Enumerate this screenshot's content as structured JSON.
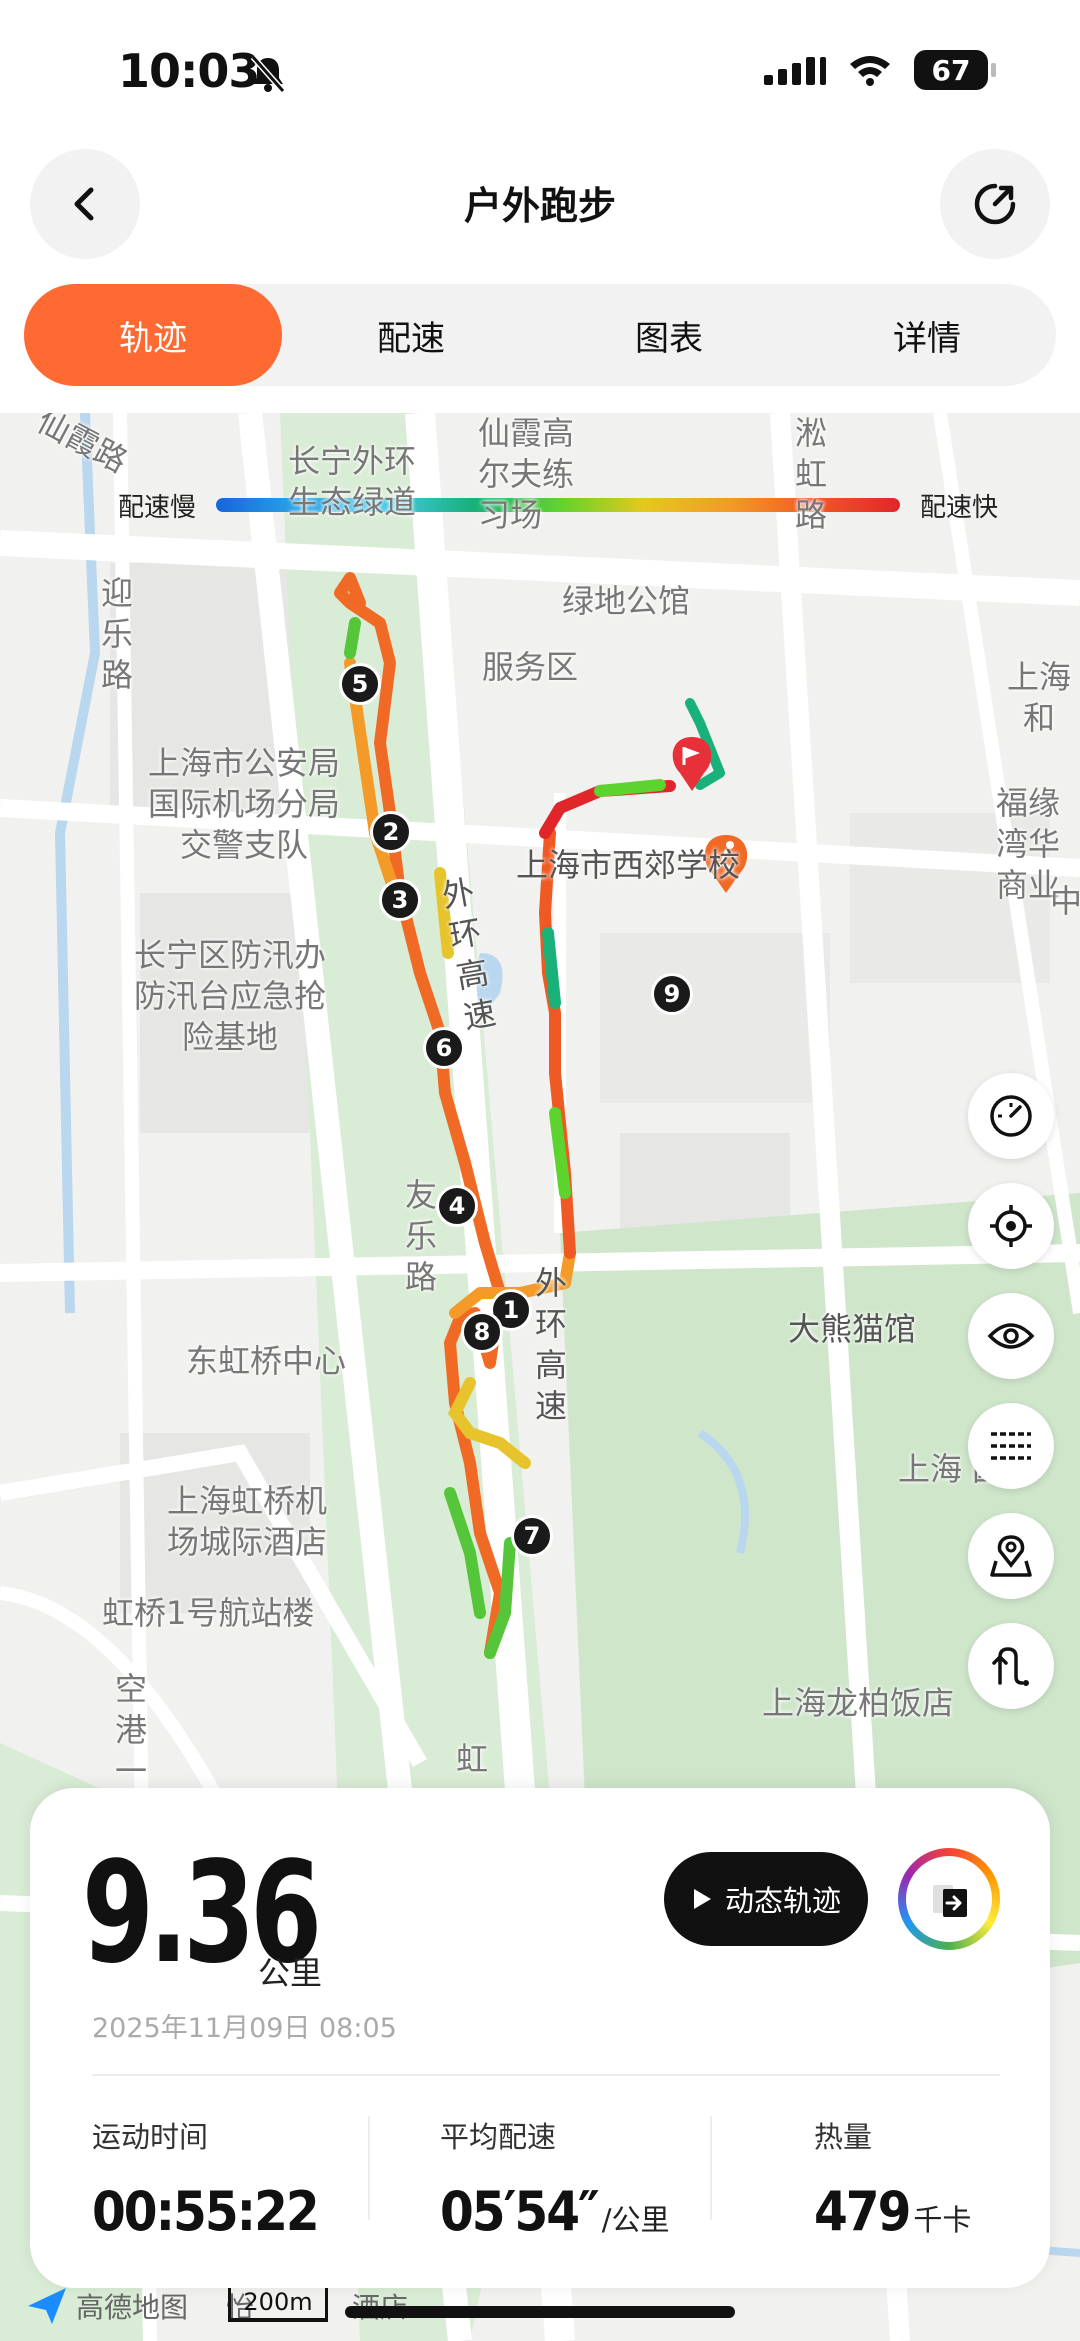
{
  "status_bar": {
    "time": "10:03",
    "battery": "67"
  },
  "header": {
    "title": "户外跑步"
  },
  "tabs": [
    {
      "label": "轨迹",
      "active": true
    },
    {
      "label": "配速",
      "active": false
    },
    {
      "label": "图表",
      "active": false
    },
    {
      "label": "详情",
      "active": false
    }
  ],
  "map": {
    "legend": {
      "slow_label": "配速慢",
      "fast_label": "配速快"
    },
    "labels": {
      "xianxia_golf": "仙霞高尔夫练习场",
      "changning_greenway": "长宁外环生态绿道",
      "xianxia_road": "仙霞路",
      "songhong_road": "淞虹路",
      "yingle_road": "迎乐路",
      "greenland_hotel": "绿地公馆",
      "service_area": "服务区",
      "shanghai_right": "上海和",
      "police_unit": "上海市公安局国际机场分局交警支队",
      "fuyuan": "福缘湾华商业",
      "middle_right": "中",
      "xijiao_school": "上海市西郊学校",
      "outer_ring_1": "外环高速",
      "flood_base": "长宁区防汛办防汛台应急抢险基地",
      "youle_road": "友乐路",
      "outer_ring_2": "外环高速",
      "panda_hall": "大熊猫馆",
      "donghongqiao": "东虹桥中心",
      "zoo_partial": "上海 园",
      "airport_hotel": "上海虹桥机场城际酒店",
      "terminal1": "虹桥1号航站楼",
      "konggang": "空港一",
      "longbai_hotel": "上海龙柏饭店",
      "hong_road": "虹"
    },
    "km_markers": [
      "1",
      "2",
      "3",
      "4",
      "5",
      "6",
      "7",
      "8",
      "9"
    ],
    "tools": [
      "speedometer-icon",
      "locate-icon",
      "eye-icon",
      "layers-icon",
      "map-pin-icon",
      "route-icon"
    ]
  },
  "stats": {
    "distance": "9.36",
    "distance_unit": "公里",
    "date": "2025年11月09日 08:05",
    "replay_label": "动态轨迹",
    "duration_label": "运动时间",
    "duration": "00:55:22",
    "pace_label": "平均配速",
    "pace": "05′54″",
    "pace_unit": "/公里",
    "calories_label": "热量",
    "calories": "479",
    "calories_unit": "千卡"
  },
  "attribution": {
    "provider": "高德地图",
    "poi_partial": "怡",
    "poi_partial_2": "酒店",
    "scale": "200m"
  },
  "colors": {
    "accent": "#ff6a33",
    "route_fast": "#e0262a",
    "route_slow": "#1565d8"
  }
}
